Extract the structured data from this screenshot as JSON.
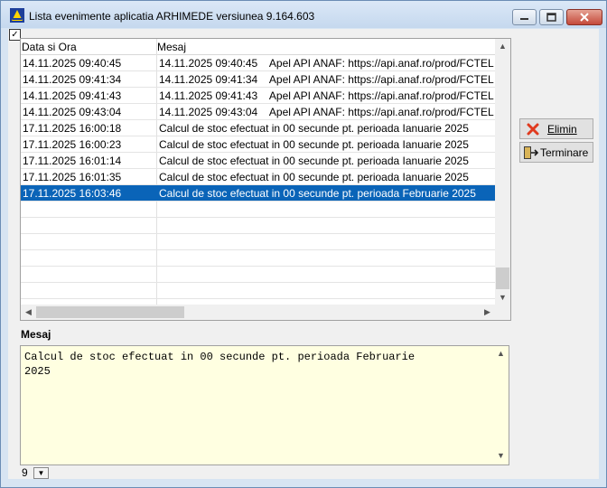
{
  "window": {
    "title": "Lista evenimente aplicatia ARHIMEDE versiunea 9.164.603",
    "checkbox_mark": "✓"
  },
  "grid": {
    "columns": [
      "Data si Ora",
      "Mesaj"
    ],
    "rows": [
      {
        "time": "14.11.2025 09:40:45",
        "msg": "14.11.2025 09:40:45    Apel API ANAF: https://api.anaf.ro/prod/FCTEL"
      },
      {
        "time": "14.11.2025 09:41:34",
        "msg": "14.11.2025 09:41:34    Apel API ANAF: https://api.anaf.ro/prod/FCTEL"
      },
      {
        "time": "14.11.2025 09:41:43",
        "msg": "14.11.2025 09:41:43    Apel API ANAF: https://api.anaf.ro/prod/FCTEL"
      },
      {
        "time": "14.11.2025 09:43:04",
        "msg": "14.11.2025 09:43:04    Apel API ANAF: https://api.anaf.ro/prod/FCTEL"
      },
      {
        "time": "17.11.2025 16:00:18",
        "msg": "Calcul de stoc efectuat in 00 secunde pt. perioada Ianuarie 2025"
      },
      {
        "time": "17.11.2025 16:00:23",
        "msg": "Calcul de stoc efectuat in 00 secunde pt. perioada Ianuarie 2025"
      },
      {
        "time": "17.11.2025 16:01:14",
        "msg": "Calcul de stoc efectuat in 00 secunde pt. perioada Ianuarie 2025"
      },
      {
        "time": "17.11.2025 16:01:35",
        "msg": "Calcul de stoc efectuat in 00 secunde pt. perioada Ianuarie 2025"
      },
      {
        "time": "17.11.2025 16:03:46",
        "msg": "Calcul de stoc efectuat in 00 secunde pt. perioada Februarie 2025"
      }
    ],
    "selected_index": 8
  },
  "buttons": {
    "delete_label": "Elimin",
    "close_label": "Terminare"
  },
  "message_section": {
    "label": "Mesaj",
    "text": "Calcul de stoc efectuat in 00 secunde pt. perioada Februarie\n2025"
  },
  "pager": {
    "value": "9"
  },
  "colors": {
    "selection": "#0a64b8",
    "memo_background": "#ffffe1",
    "delete_icon": "#e03a1e"
  }
}
